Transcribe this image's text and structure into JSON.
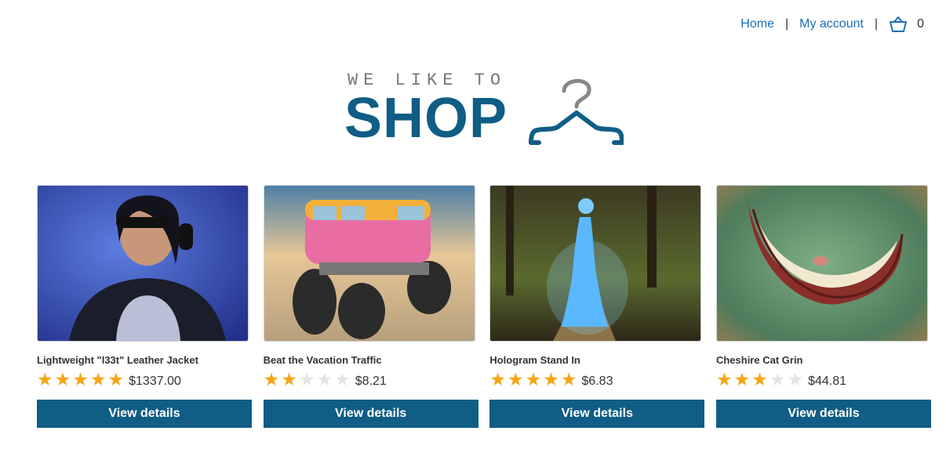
{
  "nav": {
    "home": "Home",
    "separator": "|",
    "my_account": "My account",
    "basket_icon": "basket-icon",
    "basket_count": "0"
  },
  "logo": {
    "tagline": "WE LIKE TO",
    "brand": "SHOP",
    "icon": "hanger-icon"
  },
  "colors": {
    "accent": "#105d85",
    "link": "#1a6eb8",
    "star_on": "#f6a412",
    "star_off": "#e1e5e8"
  },
  "products": [
    {
      "name": "Lightweight \"l33t\" Leather Jacket",
      "rating": 5,
      "rating_max": 5,
      "price": "$1337.00",
      "button": "View details"
    },
    {
      "name": "Beat the Vacation Traffic",
      "rating": 2,
      "rating_max": 5,
      "price": "$8.21",
      "button": "View details"
    },
    {
      "name": "Hologram Stand In",
      "rating": 5,
      "rating_max": 5,
      "price": "$6.83",
      "button": "View details"
    },
    {
      "name": "Cheshire Cat Grin",
      "rating": 3,
      "rating_max": 5,
      "price": "$44.81",
      "button": "View details"
    }
  ]
}
